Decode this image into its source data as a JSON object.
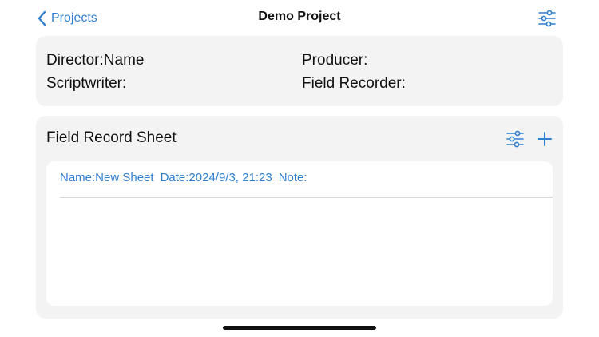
{
  "nav": {
    "back_label": "Projects",
    "title": "Demo Project",
    "settings_icon": "sliders-icon"
  },
  "info": {
    "director": "Director:Name",
    "producer": "Producer:",
    "scriptwriter": "Scriptwriter:",
    "field_recorder": "Field Recorder:"
  },
  "records": {
    "title": "Field Record Sheet",
    "settings_icon": "sliders-icon",
    "add_icon": "plus-icon",
    "sheets": [
      {
        "name": "Name:New Sheet",
        "date": "Date:2024/9/3, 21:23",
        "note": "Note:"
      }
    ]
  },
  "colors": {
    "accent": "#2f7fd0",
    "card_background": "#f3f3f3",
    "page_background": "#ffffff"
  }
}
